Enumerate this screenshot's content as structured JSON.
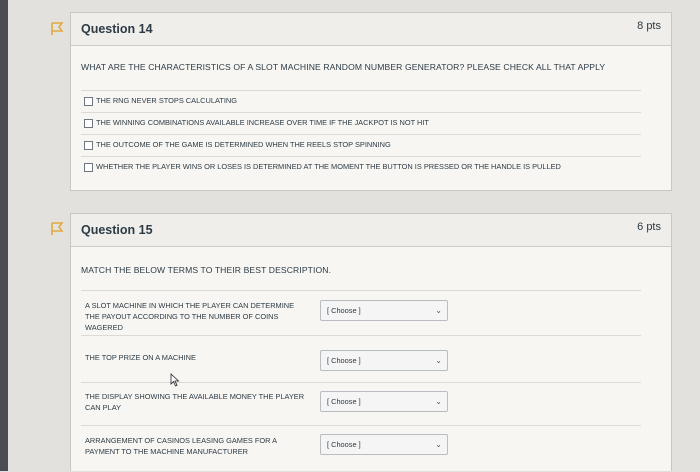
{
  "q14": {
    "title": "Question 14",
    "points": "8 pts",
    "text": "WHAT ARE THE CHARACTERISTICS OF A SLOT MACHINE RANDOM NUMBER GENERATOR? PLEASE CHECK ALL THAT APPLY",
    "options": [
      "THE RNG NEVER STOPS CALCULATING",
      "THE WINNING COMBINATIONS AVAILABLE INCREASE OVER TIME IF THE JACKPOT IS NOT HIT",
      "THE OUTCOME OF THE GAME IS DETERMINED WHEN THE REELS STOP SPINNING",
      "WHETHER THE PLAYER WINS OR LOSES IS DETERMINED AT THE MOMENT THE BUTTON IS PRESSED OR THE HANDLE IS PULLED"
    ]
  },
  "q15": {
    "title": "Question 15",
    "points": "6 pts",
    "text": "MATCH THE BELOW TERMS TO THEIR BEST DESCRIPTION.",
    "rows": [
      {
        "term": "A SLOT MACHINE IN WHICH THE PLAYER CAN DETERMINE THE PAYOUT ACCORDING TO THE NUMBER OF COINS WAGERED",
        "selected": "[ Choose ]"
      },
      {
        "term": "THE TOP PRIZE ON A MACHINE",
        "selected": "[ Choose ]"
      },
      {
        "term": "THE DISPLAY SHOWING THE AVAILABLE MONEY THE PLAYER CAN PLAY",
        "selected": "[ Choose ]"
      },
      {
        "term": "ARRANGEMENT OF CASINOS LEASING GAMES FOR A PAYMENT TO THE MACHINE MANUFACTURER",
        "selected": "[ Choose ]"
      }
    ]
  },
  "icons": {
    "flag": "flag-icon",
    "chevron": "chevron-down-icon",
    "cursor": "mouse-cursor-icon"
  },
  "colors": {
    "flag": "#e1a940",
    "text": "#2d3b45",
    "header_bg": "#efeeea"
  }
}
